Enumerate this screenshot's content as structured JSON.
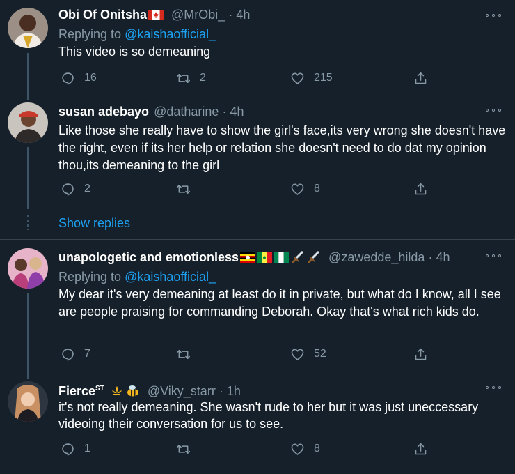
{
  "tweets": [
    {
      "name": "Obi Of Onitsha",
      "handle": "@MrObi_",
      "sep": "·",
      "time": "4h",
      "replying_prefix": "Replying to ",
      "replying_to": "@kaishaofficial_",
      "text": "This video is so demeaning",
      "reply_count": "16",
      "retweet_count": "2",
      "like_count": "215"
    },
    {
      "name": "susan adebayo",
      "handle": "@datharine",
      "sep": "·",
      "time": "4h",
      "text": "Like those she really have to show the girl's face,its very wrong she doesn't have the right, even if its her help or relation she doesn't need to do dat my opinion thou,its demeaning to the girl",
      "reply_count": "2",
      "retweet_count": "",
      "like_count": "8"
    },
    {
      "name": "unapologetic and emotionless",
      "handle": "@zawedde_hilda",
      "sep": "·",
      "time": "4h",
      "replying_prefix": "Replying to ",
      "replying_to": "@kaishaofficial_",
      "text": "My dear it's very demeaning at least do it in private, but what do I know, all I see are people praising for commanding Deborah. Okay that's what rich kids do.",
      "reply_count": "7",
      "retweet_count": "",
      "like_count": "52"
    },
    {
      "name": "Fierce",
      "name_sup": "ST",
      "handle": "@Viky_starr",
      "sep": "·",
      "time": "1h",
      "text": "it's not really demeaning. She wasn't rude to her but it was just uneccessary videoing their conversation for us to see.",
      "reply_count": "1",
      "retweet_count": "",
      "like_count": "8"
    }
  ],
  "show_replies": "Show replies",
  "colors": {
    "background": "#15202b",
    "link": "#1da1f2",
    "muted": "#8899a6",
    "divider": "#38444d"
  },
  "icons": [
    "avatar",
    "canada-flag-icon",
    "uganda-flag-icon",
    "senegal-flag-icon",
    "nigeria-flag-icon",
    "dagger-icon",
    "fleur-icon",
    "bee-icon",
    "more-icon",
    "reply-icon",
    "retweet-icon",
    "like-icon",
    "share-icon"
  ]
}
